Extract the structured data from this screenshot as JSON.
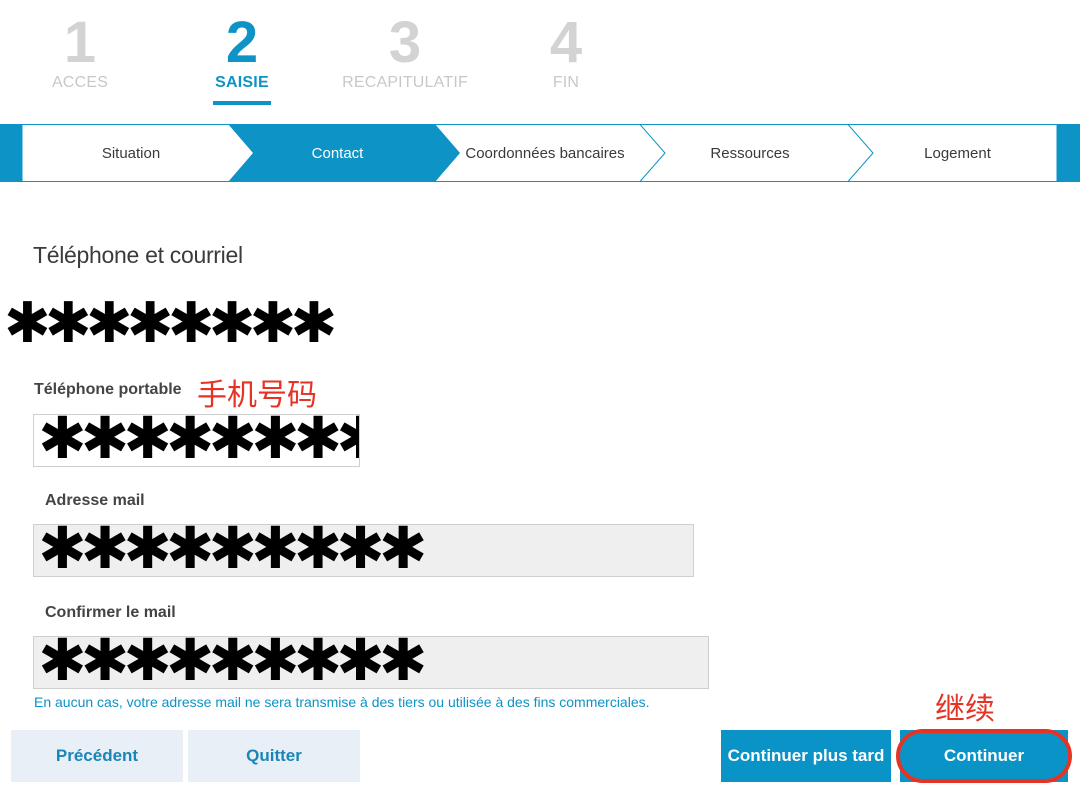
{
  "steps": [
    {
      "number": "1",
      "label": "ACCES",
      "active": false
    },
    {
      "number": "2",
      "label": "SAISIE",
      "active": true
    },
    {
      "number": "3",
      "label": "RECAPITULATIF",
      "active": false
    },
    {
      "number": "4",
      "label": "FIN",
      "active": false
    }
  ],
  "progress_tabs": [
    {
      "label": "Situation",
      "active": false
    },
    {
      "label": "Contact",
      "active": true
    },
    {
      "label": "Coordonnées bancaires",
      "active": false
    },
    {
      "label": "Ressources",
      "active": false
    },
    {
      "label": "Logement",
      "active": false
    }
  ],
  "section_title": "Téléphone et courriel",
  "masked_text": "✱✱✱✱✱✱✱✱",
  "fields": {
    "phone": {
      "label": "Téléphone portable",
      "annotation": "手机号码",
      "value": "✱✱✱✱✱✱✱✱"
    },
    "email": {
      "label": "Adresse mail",
      "value": "✱✱✱✱✱✱✱✱✱"
    },
    "email_confirm": {
      "label": "Confirmer le mail",
      "value": "✱✱✱✱✱✱✱✱✱"
    }
  },
  "note": "En aucun cas, votre adresse mail ne sera transmise à des tiers ou utilisée à des fins commerciales.",
  "buttons": {
    "previous": "Précédent",
    "quit": "Quitter",
    "continue_later": "Continuer plus tard",
    "continue": "Continuer",
    "continue_annotation": "继续"
  },
  "colors": {
    "accent": "#0d93c5",
    "annotation": "#e53325"
  }
}
